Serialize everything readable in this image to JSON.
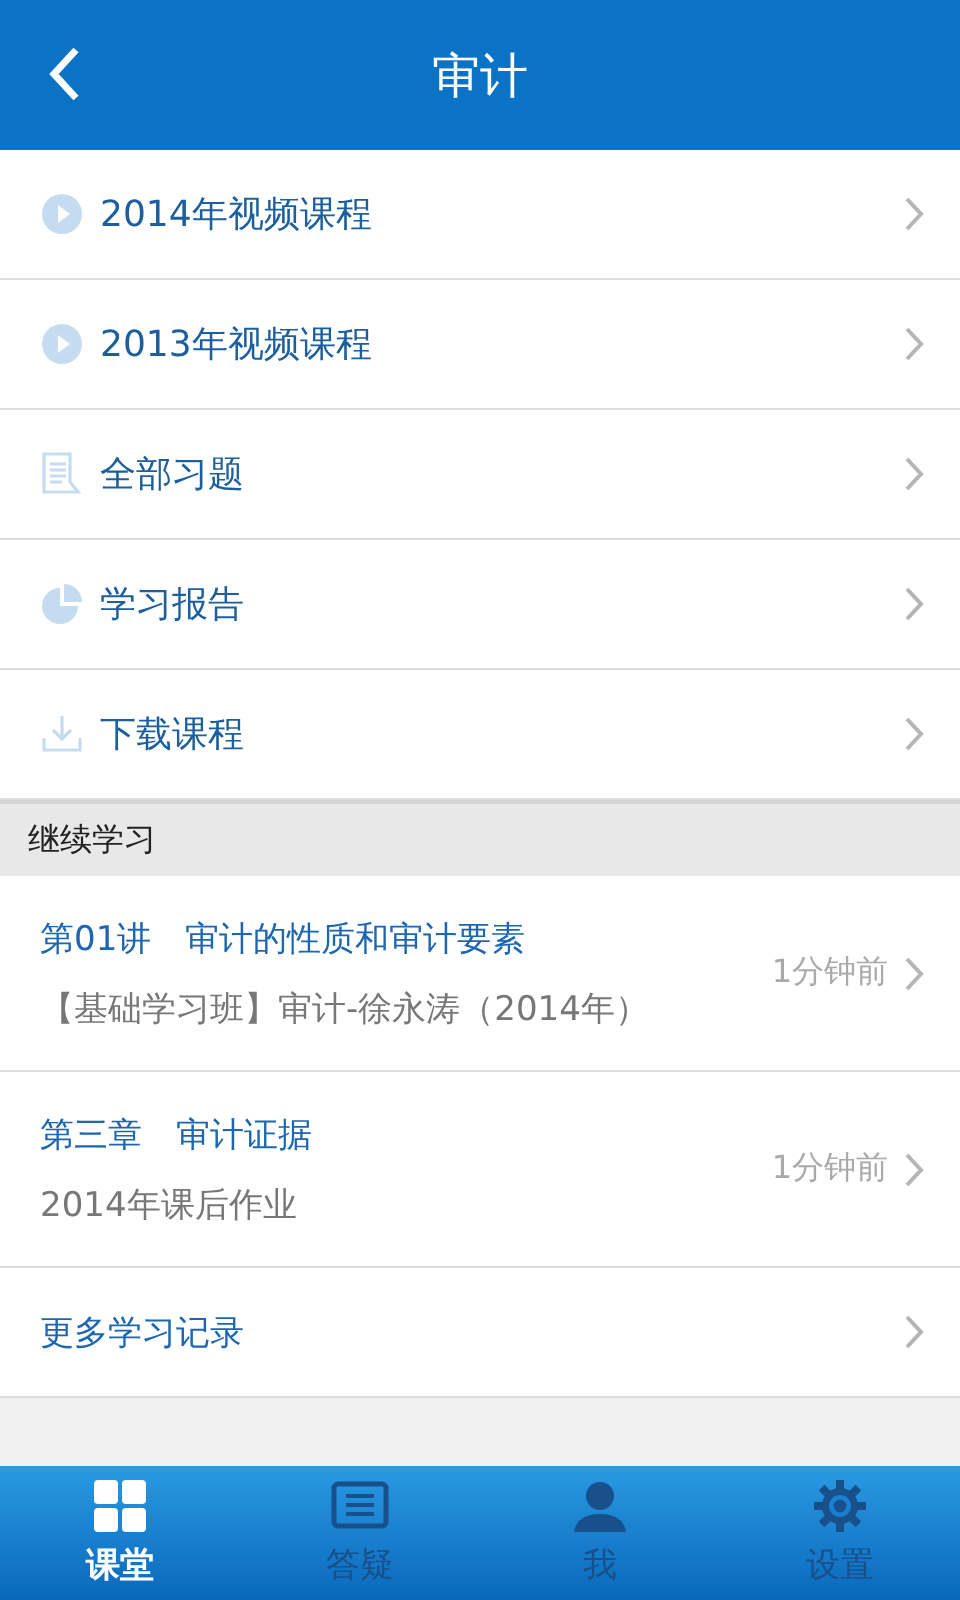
{
  "header": {
    "title": "审计"
  },
  "menu": [
    {
      "kind": "video",
      "label": "2014年视频课程"
    },
    {
      "kind": "video",
      "label": "2013年视频课程"
    },
    {
      "kind": "exercises",
      "label": "全部习题"
    },
    {
      "kind": "report",
      "label": "学习报告"
    },
    {
      "kind": "download",
      "label": "下载课程"
    }
  ],
  "continue_section": {
    "title": "继续学习",
    "records": [
      {
        "title": "第01讲　审计的性质和审计要素",
        "subtitle": "【基础学习班】审计-徐永涛（2014年）",
        "time": "1分钟前"
      },
      {
        "title": "第三章　审计证据",
        "subtitle": "2014年课后作业",
        "time": "1分钟前"
      }
    ],
    "more": "更多学习记录"
  },
  "tab_bar": [
    {
      "kind": "grid",
      "label": "课堂",
      "selected": true
    },
    {
      "kind": "list",
      "label": "答疑",
      "selected": false
    },
    {
      "kind": "person",
      "label": "我",
      "selected": false
    },
    {
      "kind": "gear",
      "label": "设置",
      "selected": false
    }
  ]
}
